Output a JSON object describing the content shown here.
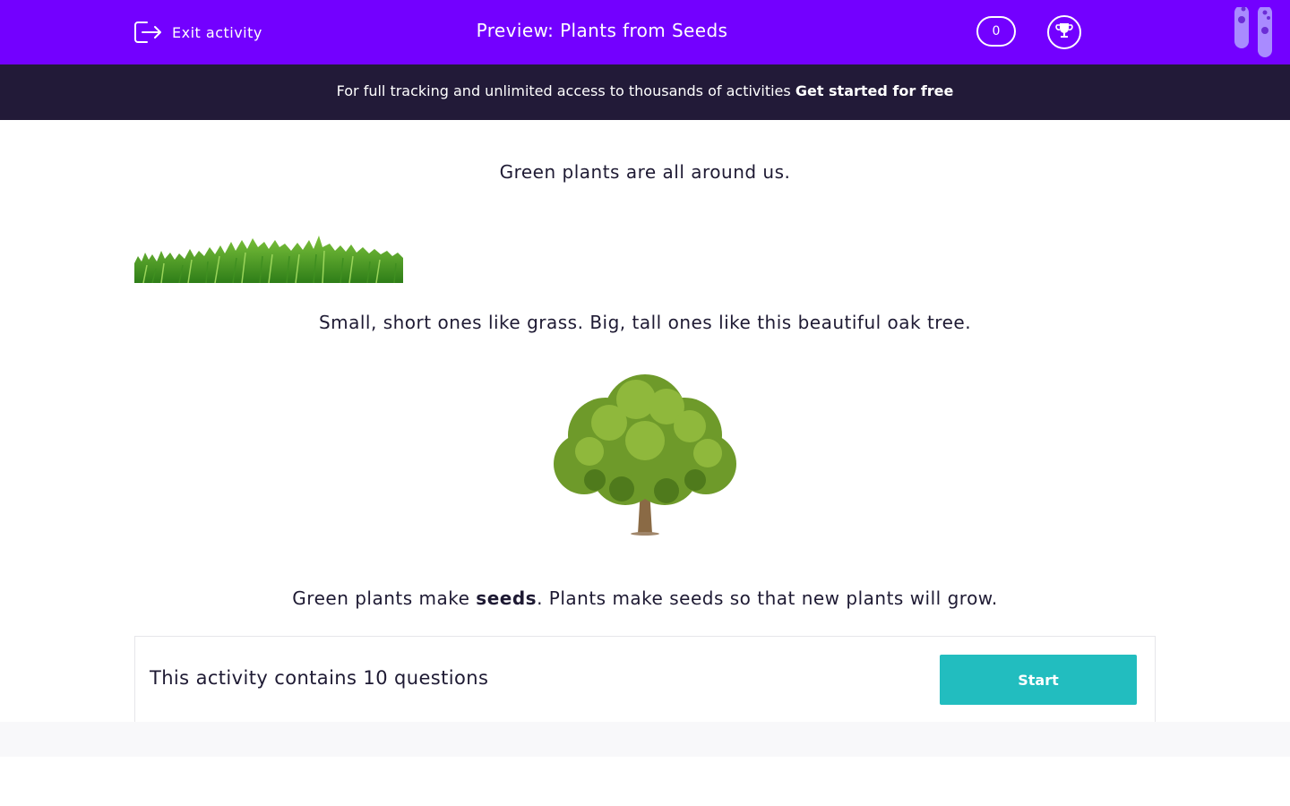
{
  "header": {
    "exit_label": "Exit activity",
    "title": "Preview: Plants from Seeds",
    "score": "0",
    "exit_icon": "exit-icon",
    "trophy_icon": "trophy-icon",
    "background_color": "#7300ff"
  },
  "promo": {
    "text": "For full tracking and unlimited access to thousands of activities",
    "link": "Get started for free",
    "background_color": "#221a38"
  },
  "content": {
    "intro": "Green plants are all around us.",
    "sizes": "Small, short ones like grass. Big, tall ones like this beautiful oak tree.",
    "seeds_before": "Green plants make ",
    "seeds_bold": "seeds",
    "seeds_after": ". Plants make seeds so that new plants will grow.",
    "images": [
      "grass",
      "oak tree"
    ]
  },
  "activity": {
    "summary": "This activity contains 10 questions",
    "start_label": "Start",
    "accent_color": "#22bdbf"
  }
}
